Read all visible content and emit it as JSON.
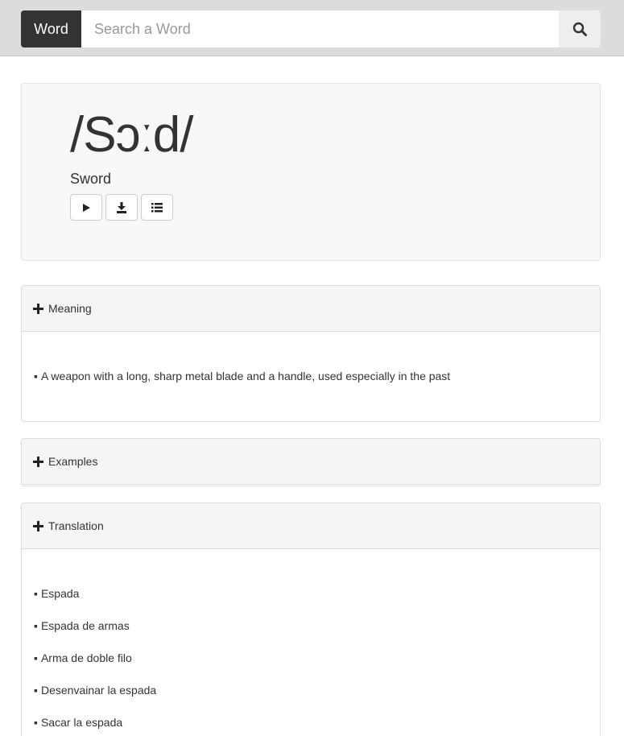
{
  "search": {
    "mode_label": "Word",
    "placeholder": "Search a Word",
    "value": ""
  },
  "entry": {
    "phonetic": "/Sɔːd/",
    "word": "Sword"
  },
  "actions": {
    "icons": [
      "play-icon",
      "download-icon",
      "list-icon"
    ]
  },
  "meaning": {
    "title": "Meaning",
    "items": [
      "A weapon with a long, sharp metal blade and a handle, used especially in the past"
    ]
  },
  "examples": {
    "title": "Examples"
  },
  "translation": {
    "title": "Translation",
    "items": [
      "Espada",
      "Espada de armas",
      "Arma de doble filo",
      "Desenvainar la espada",
      "Sacar la espada"
    ]
  },
  "colors": {
    "topbar": "#dcdcdc",
    "word_button": "#333333",
    "card": "#f8f8f8",
    "panel_header": "#f5f5f5"
  }
}
